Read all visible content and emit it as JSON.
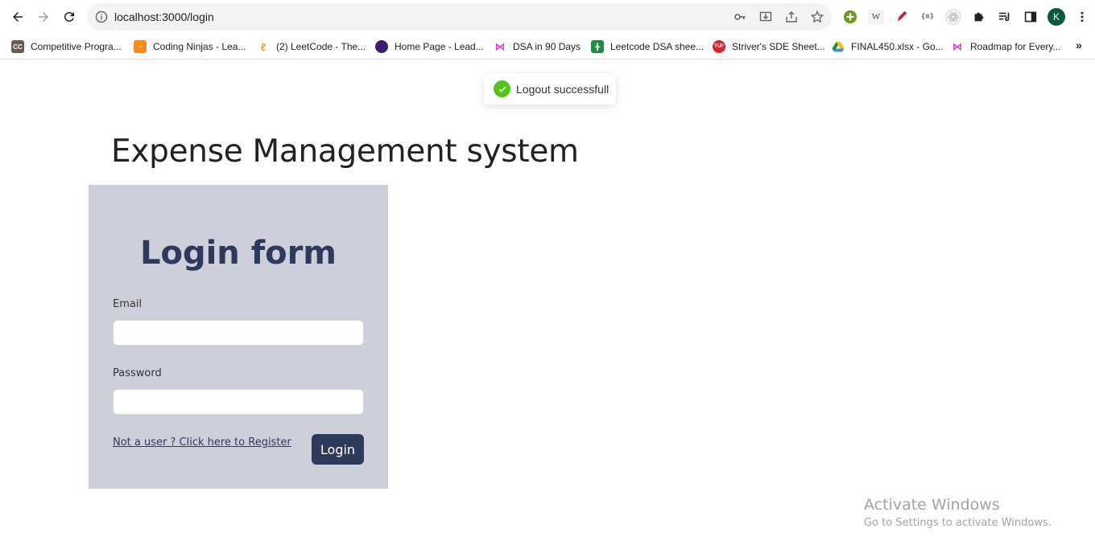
{
  "browser": {
    "url": "localhost:3000/login",
    "bookmarks": [
      {
        "label": "Competitive Progra...",
        "color": "#6d5b4d",
        "icon": "cc-icon"
      },
      {
        "label": "Coding Ninjas - Lea...",
        "color": "#f58a1f",
        "icon": "coding-ninjas-icon"
      },
      {
        "label": "(2) LeetCode - The...",
        "color": "#e7a41f",
        "icon": "leetcode-icon"
      },
      {
        "label": "Home Page - Lead...",
        "color": "#3a1d6e",
        "icon": "home-page-icon"
      },
      {
        "label": "DSA in 90 Days",
        "color": "#d63de0",
        "icon": "dsa-icon"
      },
      {
        "label": "Leetcode DSA shee...",
        "color": "#1e8e3e",
        "icon": "sheets-icon"
      },
      {
        "label": "Striver's SDE Sheet...",
        "color": "#e02032",
        "icon": "tuf-icon"
      },
      {
        "label": "FINAL450.xlsx - Go...",
        "color": "#fbbc04",
        "icon": "drive-icon"
      },
      {
        "label": "Roadmap for Every...",
        "color": "#d63de0",
        "icon": "roadmap-icon"
      }
    ],
    "avatar_letter": "K"
  },
  "toast": {
    "message": "Logout successfull",
    "color": "#52c41a"
  },
  "page": {
    "heading": "Expense Management system"
  },
  "login_form": {
    "title": "Login form",
    "email_label": "Email",
    "email_value": "",
    "password_label": "Password",
    "password_value": "",
    "register_link": "Not a user ? Click here to Register",
    "login_button": "Login",
    "accent": "#2e3a5c",
    "panel_bg": "#cdcfdb"
  },
  "watermark": {
    "line1": "Activate Windows",
    "line2": "Go to Settings to activate Windows."
  }
}
